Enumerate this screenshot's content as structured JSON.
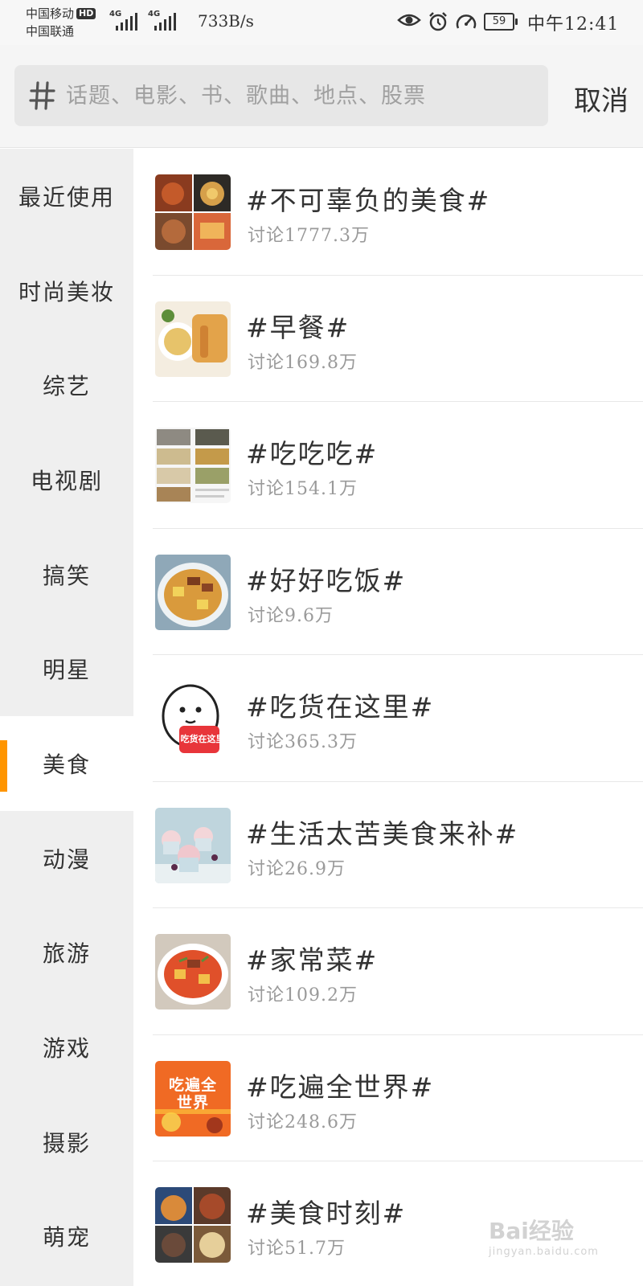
{
  "status_bar": {
    "carrier_1": "中国移动",
    "hd_badge": "HD",
    "carrier_2": "中国联通",
    "sim1_network": "4G",
    "sim2_network": "4G",
    "net_speed": "733B/s",
    "battery_level": "59",
    "time": "中午12:41",
    "icons": [
      "eye-icon",
      "alarm-icon",
      "speedometer-icon"
    ]
  },
  "search": {
    "placeholder": "话题、电影、书、歌曲、地点、股票",
    "cancel_label": "取消",
    "icon": "hash-icon"
  },
  "sidebar": {
    "items": [
      {
        "label": "最近使用"
      },
      {
        "label": "时尚美妆"
      },
      {
        "label": "综艺"
      },
      {
        "label": "电视剧"
      },
      {
        "label": "搞笑"
      },
      {
        "label": "明星"
      },
      {
        "label": "美食",
        "active": true
      },
      {
        "label": "动漫"
      },
      {
        "label": "旅游"
      },
      {
        "label": "游戏"
      },
      {
        "label": "摄影"
      },
      {
        "label": "萌宠"
      }
    ],
    "accent_color": "#ff9500"
  },
  "topics": [
    {
      "title": "#不可辜负的美食#",
      "count": "讨论1777.3万"
    },
    {
      "title": "#早餐#",
      "count": "讨论169.8万"
    },
    {
      "title": "#吃吃吃#",
      "count": "讨论154.1万"
    },
    {
      "title": "#好好吃饭#",
      "count": "讨论9.6万"
    },
    {
      "title": "#吃货在这里#",
      "count": "讨论365.3万",
      "thumb_text": "吃货在这里"
    },
    {
      "title": "#生活太苦美食来补#",
      "count": "讨论26.9万"
    },
    {
      "title": "#家常菜#",
      "count": "讨论109.2万"
    },
    {
      "title": "#吃遍全世界#",
      "count": "讨论248.6万",
      "thumb_text": "吃遍全世界"
    },
    {
      "title": "#美食时刻#",
      "count": "讨论51.7万"
    }
  ],
  "watermark": {
    "brand": "Bai经验",
    "url": "jingyan.baidu.com"
  }
}
